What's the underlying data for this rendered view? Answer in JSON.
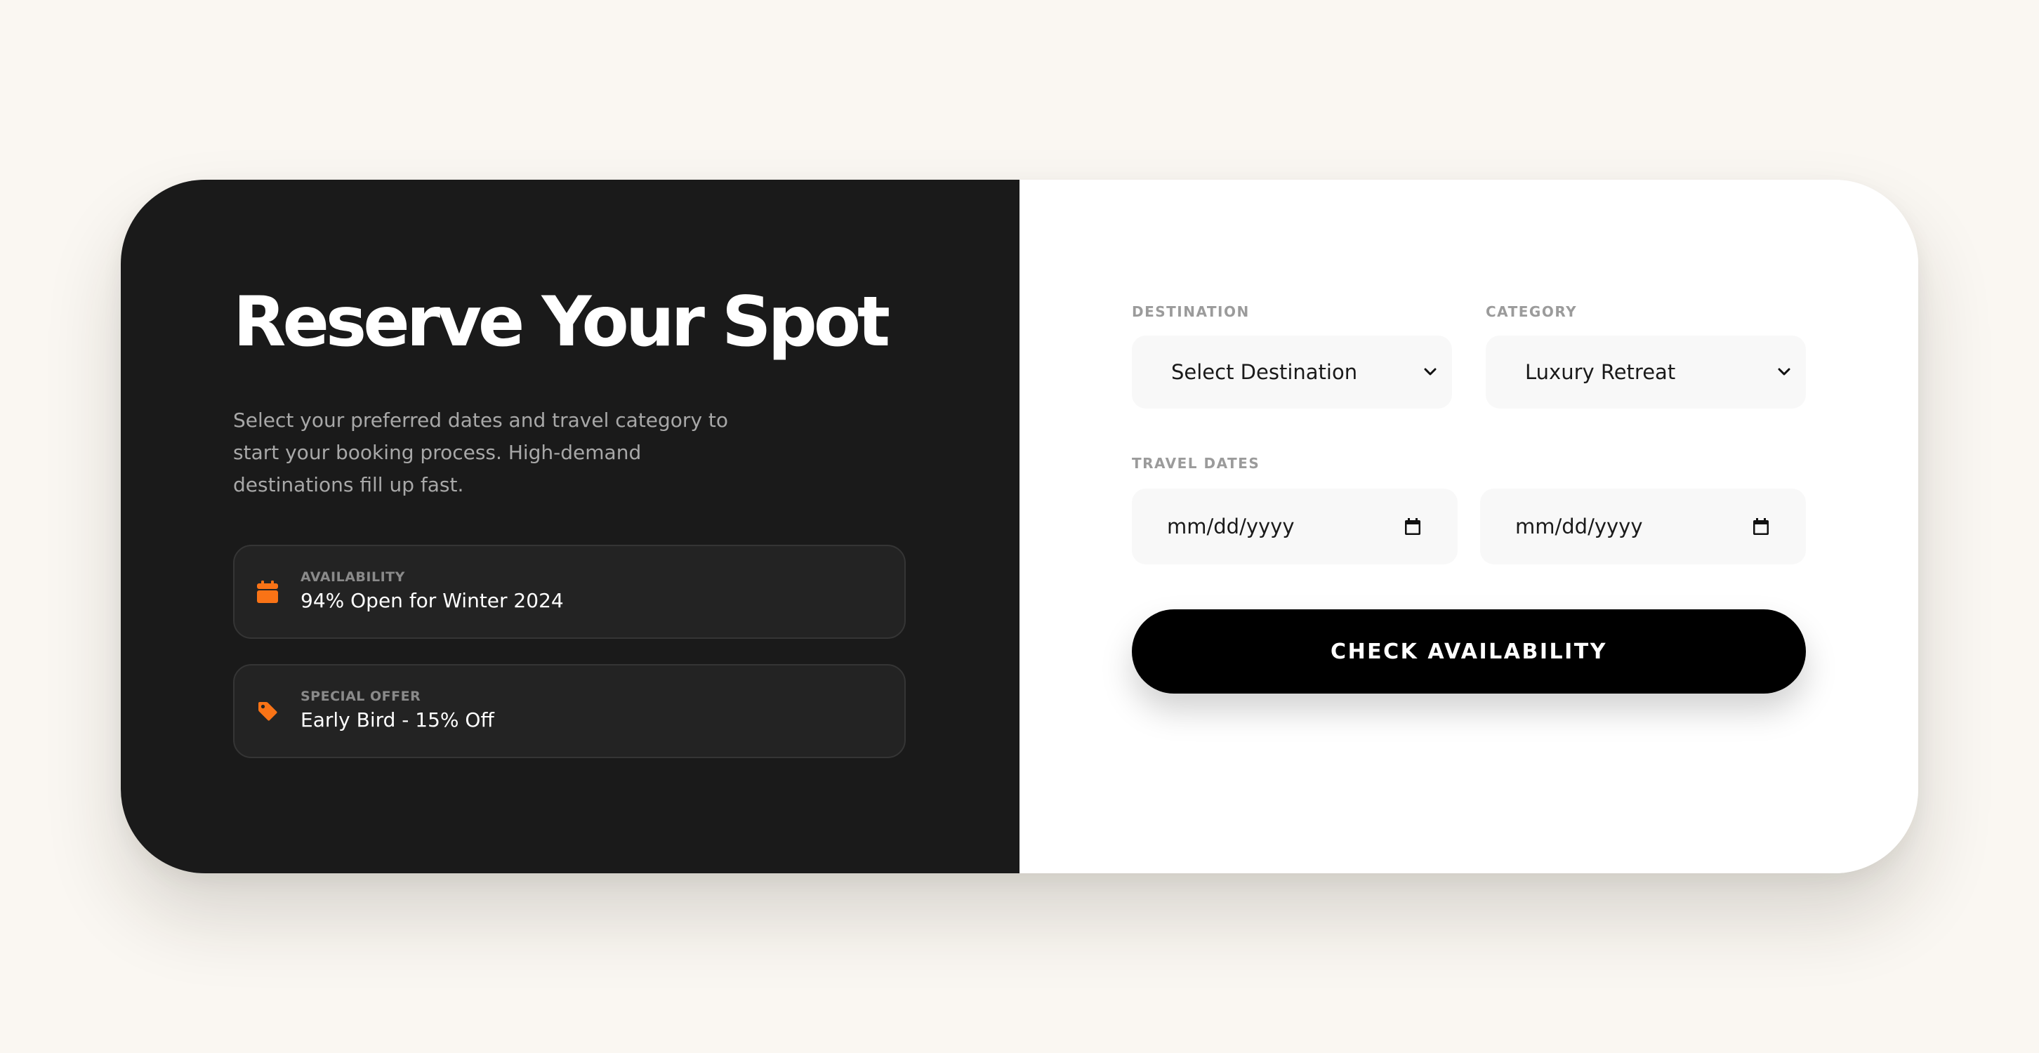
{
  "booking": {
    "title": "Reserve Your Spot",
    "description": "Select your preferred dates and travel category to start your booking process. High-demand destinations fill up fast.",
    "availability": {
      "label": "AVAILABILITY",
      "value": "94% Open for Winter 2024",
      "icon": "calendar-icon"
    },
    "offer": {
      "label": "SPECIAL OFFER",
      "value": "Early Bird - 15% Off",
      "icon": "tag-icon"
    }
  },
  "form": {
    "destination": {
      "label": "DESTINATION",
      "selected": "Select Destination"
    },
    "category": {
      "label": "CATEGORY",
      "selected": "Luxury Retreat"
    },
    "travel_dates": {
      "label": "TRAVEL DATES",
      "start_placeholder": "mm/dd/yyyy",
      "end_placeholder": "mm/dd/yyyy"
    },
    "submit_label": "CHECK AVAILABILITY"
  },
  "colors": {
    "page_background": "#faf7f2",
    "panel_dark": "#1a1a1a",
    "accent": "#f97316",
    "button": "#000000"
  }
}
